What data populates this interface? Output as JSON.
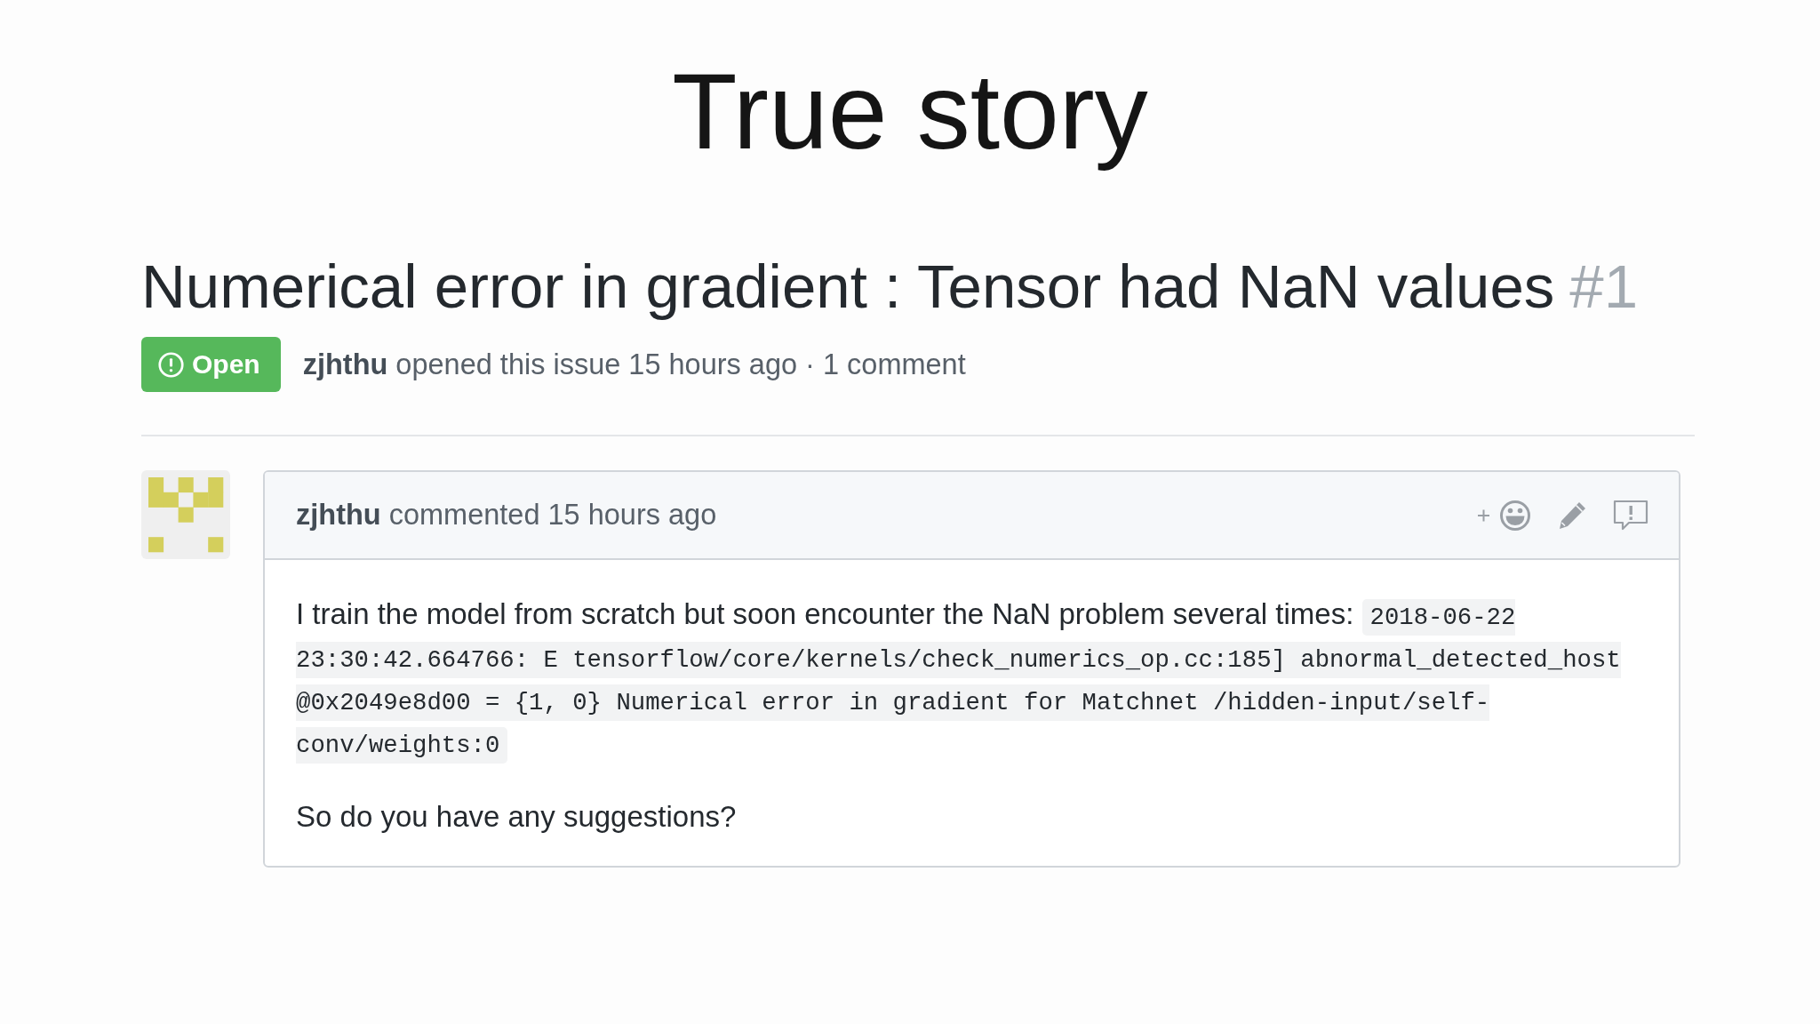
{
  "slide": {
    "title": "True story"
  },
  "issue": {
    "title": "Numerical error in gradient : Tensor had NaN values",
    "number": "#1",
    "status": {
      "label": "Open"
    },
    "meta": "**zjhthu** opened this issue 15 hours ago · 1 comment"
  },
  "comments": [
    {
      "header": "**zjhthu** commented 15 hours ago",
      "body": [
        {
          "kind": "text_with_code",
          "text": "I train the model from scratch but soon encounter the NaN problem several times:",
          "code": "2018-06-22 23:30:42.664766: E tensorflow/core/kernels/check_numerics_op.cc:185] abnormal_detected_host @0x2049e8d00 = {1, 0} Numerical error in gradient for Matchnet /hidden-input/self-conv/weights:0"
        },
        {
          "kind": "text",
          "text": "So do you have any suggestions?"
        }
      ]
    }
  ]
}
